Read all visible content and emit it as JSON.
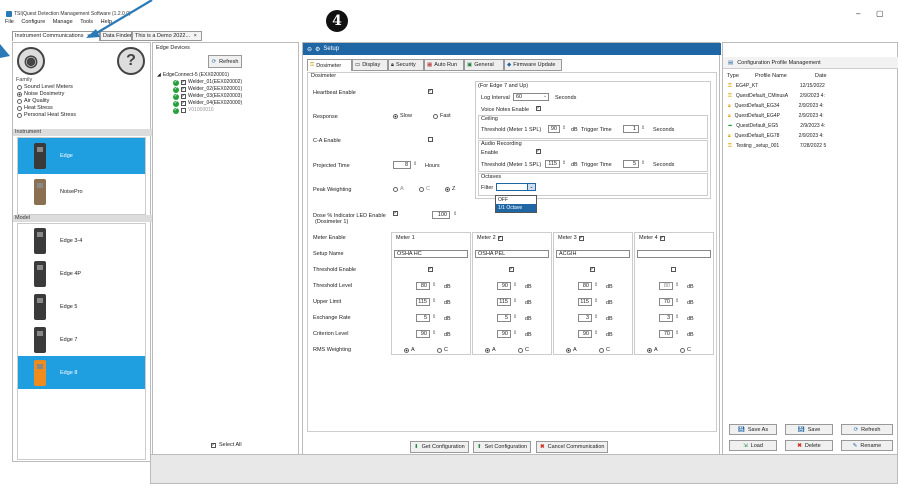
{
  "window": {
    "title": "TSI|Quest Detection Management Software (1.2.0.0)",
    "minimize": "–",
    "restore": "▢"
  },
  "menu": [
    "File",
    "Configure",
    "Manage",
    "Tools",
    "Help"
  ],
  "tabs": [
    {
      "label": "Instrument Communications",
      "close": "×"
    },
    {
      "label": "Data Finder"
    },
    {
      "label": "This is a Demo 2022...",
      "close": "×"
    }
  ],
  "annotation": {
    "step": "4"
  },
  "left": {
    "family_title": "Family",
    "family": [
      "Sound Level Meters",
      "Noise Dosimetry",
      "Air Quality",
      "Heat Stress",
      "Personal Heat Stress"
    ],
    "family_selected": 1,
    "instrument_title": "Instrument",
    "instruments": [
      "Edge",
      "NoisePro"
    ],
    "model_title": "Model",
    "models": [
      "Edge 3-4",
      "Edge 4P",
      "Edge 5",
      "Edge 7",
      "Edge 8"
    ]
  },
  "edge": {
    "title": "Edge Devices",
    "refresh": "Refresh",
    "root": "EdgeConnect-5 (EXX020001)",
    "devices": [
      "Welder_01(EEX020002)",
      "Welder_02(EEX020001)",
      "Welder_03(EEX020003)",
      "Welder_04(EEX020000)",
      "V01000010"
    ],
    "select_all": "Select All"
  },
  "setup": {
    "header": "Setup",
    "tabs": [
      "Dosimeter",
      "Display",
      "Security",
      "Auto Run",
      "General",
      "Firmware Update"
    ],
    "dosimeter_title": "Dosimeter",
    "heartbeat": "Heartbeat Enable",
    "response": "Response",
    "slow": "Slow",
    "fast": "Fast",
    "ca_enable": "C-A Enable",
    "projected_time": "Projected Time",
    "projected_value": "8",
    "hours": "Hours",
    "peak_weighting": "Peak Weighting",
    "peak_a": "A",
    "peak_c": "C",
    "peak_z": "Z",
    "dose_led": "Dose % Indicator LED Enable",
    "dose_led_sub": "(Dosimeter 1)",
    "dose_value": "100",
    "edge7_title": "(For Edge 7 and Up)",
    "log_interval": "Log Interval",
    "log_value": "60",
    "seconds": "Seconds",
    "voice_notes": "Voice Notes Enable",
    "ceiling": "Ceiling",
    "threshold_spl": "Threshold (Meter 1 SPL)",
    "ceiling_threshold": "90",
    "db": "dB",
    "trigger_time": "Trigger Time",
    "ceiling_trigger": "1",
    "audio_recording": "Audio Recording",
    "enable": "Enable",
    "audio_threshold": "115",
    "audio_trigger": "5",
    "octaves": "Octaves",
    "filter": "Filter",
    "filter_options": [
      "OFF",
      "1/1 Octave"
    ],
    "meter_rows": [
      "Meter Enable",
      "Setup Name",
      "Threshold Enable",
      "Threshold Level",
      "Upper Limit",
      "Exchange Rate",
      "Criterion Level",
      "RMS Weighting"
    ],
    "meters": [
      {
        "name": "Meter 1",
        "setup": "OSHA HC",
        "thr": "80",
        "upper": "115",
        "exch": "5",
        "crit": "90"
      },
      {
        "name": "Meter 2",
        "setup": "OSHA PEL",
        "thr": "90",
        "upper": "115",
        "exch": "5",
        "crit": "90"
      },
      {
        "name": "Meter 3",
        "setup": "ACGIH",
        "thr": "80",
        "upper": "115",
        "exch": "3",
        "crit": "90"
      },
      {
        "name": "Meter 4",
        "setup": "",
        "thr": "80",
        "upper": "70",
        "exch": "3",
        "crit": "70"
      }
    ],
    "rms_a": "A",
    "rms_c": "C",
    "get_config": "Get Configuration",
    "set_config": "Set Configuration",
    "cancel_comm": "Cancel Communication"
  },
  "right": {
    "title": "Configuration Profile Management",
    "col_type": "Type",
    "col_name": "Profile Name",
    "col_date": "Date",
    "profiles": [
      {
        "name": "EG4P_KT",
        "date": "12/15/2022"
      },
      {
        "name": "QuestDefault_CMinusA",
        "date": "2/9/2023 4:"
      },
      {
        "name": "QuestDefault_EG34",
        "date": "2/9/2023 4:"
      },
      {
        "name": "QuestDefault_EG4P",
        "date": "2/9/2023 4:"
      },
      {
        "name": "QuestDefault_EG5",
        "date": "2/9/2023 4:"
      },
      {
        "name": "QuestDefault_EG78",
        "date": "2/9/2023 4:"
      },
      {
        "name": "Testing _setup_001",
        "date": "7/28/2022 5"
      }
    ],
    "save_as": "Save As",
    "save": "Save",
    "refresh": "Refresh",
    "load": "Load",
    "delete": "Delete",
    "rename": "Rename"
  },
  "colors": {
    "accent": "#1f9fe0",
    "header": "#1f66a5",
    "annotation_arrow": "#2a7ab8"
  }
}
